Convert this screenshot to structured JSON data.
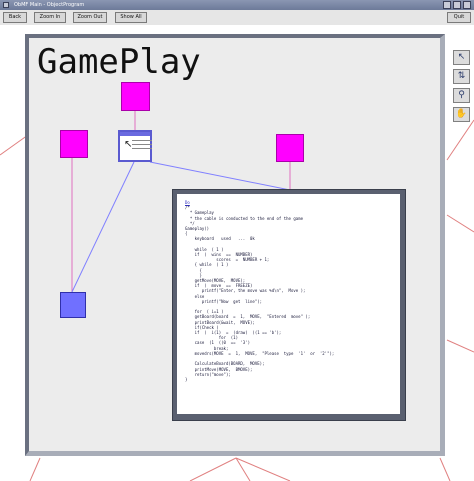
{
  "window": {
    "title": "ObMF Main - ObjectProgram"
  },
  "toolbar": {
    "buttons": [
      {
        "label": "Back"
      },
      {
        "label": "Zoom In"
      },
      {
        "label": "Zoom Out"
      },
      {
        "label": "Show All"
      },
      {
        "label": "Quit"
      }
    ]
  },
  "canvas": {
    "title": "GamePlay"
  },
  "tools": [
    {
      "icon": "pointer-icon"
    },
    {
      "icon": "connect-icon"
    },
    {
      "icon": "zoom-icon"
    },
    {
      "icon": "hand-icon"
    }
  ],
  "code": {
    "header": "Do",
    "lines": [
      "/*",
      "  * Gameplay",
      "  * the cable is conducted to the end of the game",
      "  */",
      "Gameplay()",
      "{",
      "    keyboard   used   ...  0k",
      "",
      "    while  ( 1 )",
      "    if  (  wins  ==  NUMBER)",
      "             scores  =  NUMBER + 1;",
      "    { while  ( 1 )",
      "      {",
      "      }",
      "    getMove(MOVE,  MOVE);",
      "    if  (  move  ==  FREEZE)",
      "       printf(\"Enter, the move was %d\\n\",  Move );",
      "    else",
      "       printf(\"Now  get  line\");",
      "",
      "    for  ( i=1 )",
      "    getBoard(board  =  1,  MOVE,  \"Entered  move\" );",
      "    printBoard(&wait,  MOVE);",
      "    if(Check )",
      "    if  (  i(1)  =  (draw)  ((1 == 'b');",
      "              for  (1)",
      "    case  (1  ((0  ==  '3')",
      "            break;",
      "    movedrs(MOVE  =  1,  MOVE,  \"Please  type  '1'  or  '2'\");",
      "",
      "    CalculateBoard(BOARD,  MOVE);",
      "    printMove(MOVE,  BMOVE);",
      "    return(\"move\");",
      "}"
    ]
  },
  "colors": {
    "node_task": "#ff00ff",
    "node_terminal": "#7070ff",
    "edge_tree": "#e070c0",
    "edge_flow": "#8080ff",
    "background_edges": "#e08080"
  }
}
